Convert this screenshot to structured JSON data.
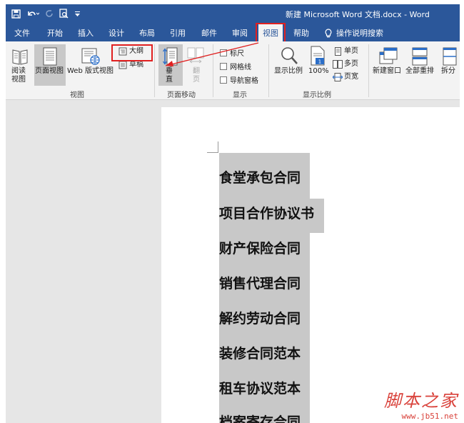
{
  "window": {
    "doc_title": "新建 Microsoft Word 文档.docx  -  Word",
    "qat": {
      "save_icon": "save-icon",
      "undo_icon": "undo-icon",
      "redo_icon": "redo-icon",
      "print_preview_icon": "print-preview-icon",
      "customize_icon": "customize-qat-icon"
    }
  },
  "tabs": [
    {
      "label": "文件"
    },
    {
      "label": "开始"
    },
    {
      "label": "插入"
    },
    {
      "label": "设计"
    },
    {
      "label": "布局"
    },
    {
      "label": "引用"
    },
    {
      "label": "邮件"
    },
    {
      "label": "审阅"
    },
    {
      "label": "视图",
      "active": true
    },
    {
      "label": "帮助"
    }
  ],
  "tell_me": "操作说明搜索",
  "ribbon": {
    "views": {
      "read_mode": "阅读\n视图",
      "print_layout": "页面视图",
      "web_layout": "Web 版式视图",
      "outline": "大纲",
      "draft": "草稿",
      "group_label": "视图"
    },
    "page_movement": {
      "vertical": "垂\n直",
      "side_to_side": "翻\n页",
      "group_label": "页面移动"
    },
    "show": {
      "ruler": "标尺",
      "gridlines": "网格线",
      "nav_pane": "导航窗格",
      "group_label": "显示"
    },
    "zoom": {
      "zoom": "显示比例",
      "hundred": "100%",
      "one_page": "单页",
      "multi_page": "多页",
      "page_width": "页宽",
      "group_label": "显示比例"
    },
    "window": {
      "new_window": "新建窗口",
      "arrange_all": "全部重排",
      "split": "拆分"
    }
  },
  "document": {
    "lines": [
      "食堂承包合同",
      "项目合作协议书",
      "财产保险合同",
      "销售代理合同",
      "解约劳动合同",
      "装修合同范本",
      "租车协议范本",
      "档案寄存合同"
    ]
  },
  "watermark": {
    "main": "脚本之家",
    "url": "www.jb51.net"
  },
  "colors": {
    "title_bar": "#2b579a",
    "highlight": "#e02020",
    "selection": "#c8c8c8"
  }
}
